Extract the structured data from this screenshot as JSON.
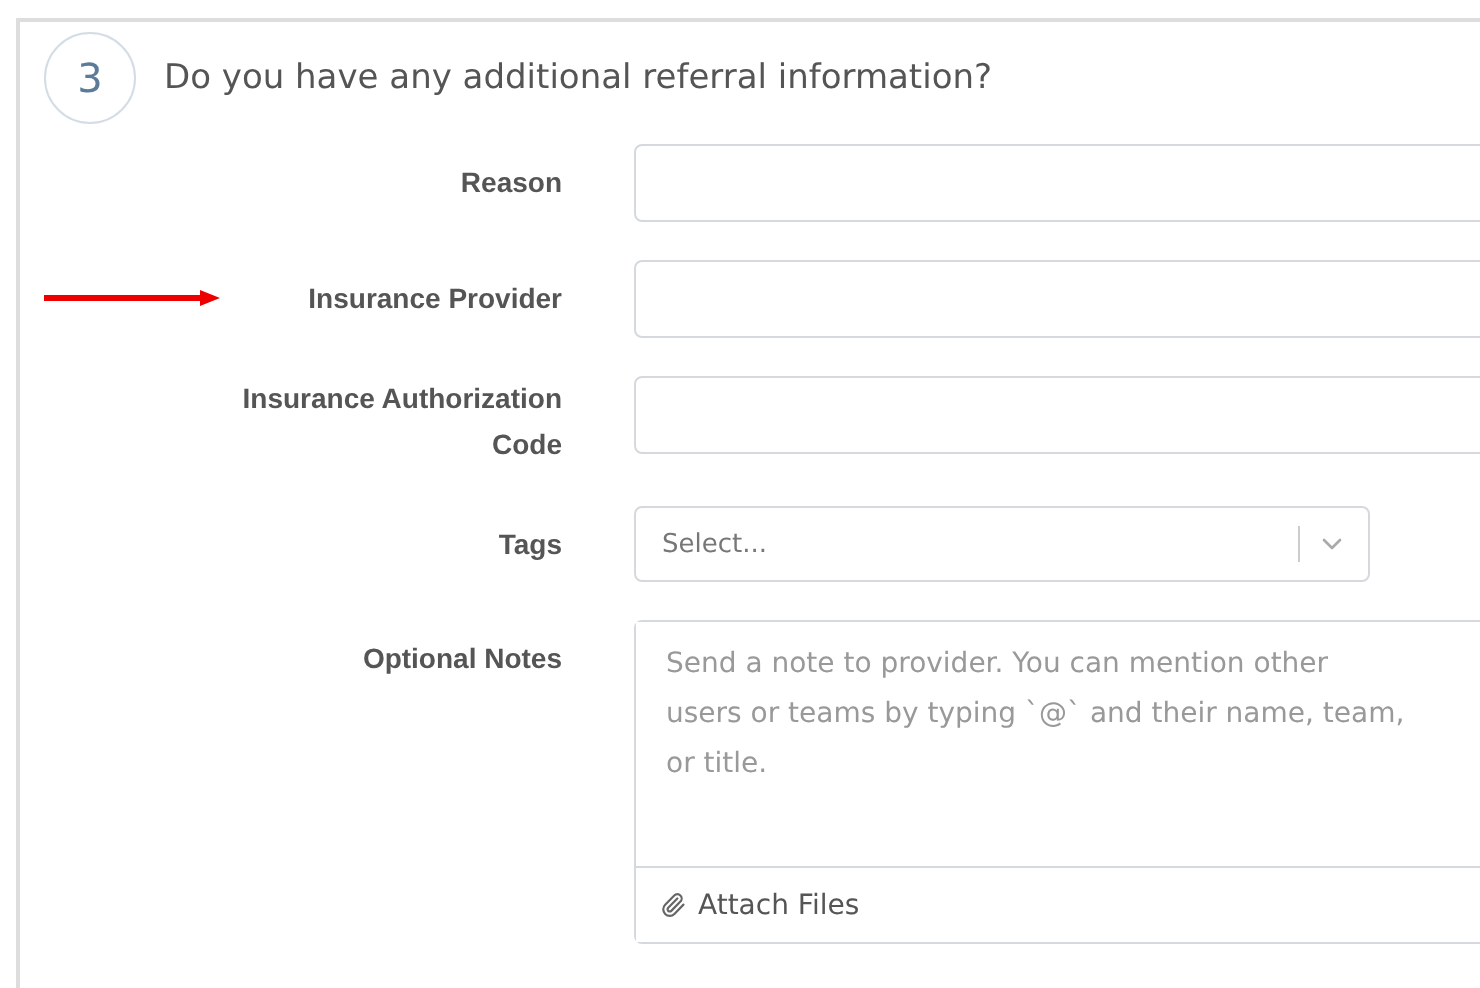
{
  "section": {
    "step": "3",
    "title": "Do you have any additional referral information?"
  },
  "fields": [
    {
      "kind": "text",
      "label": "Reason",
      "highlighted": false
    },
    {
      "kind": "text",
      "label": "Insurance Provider",
      "highlighted": true
    },
    {
      "kind": "text",
      "label": "Insurance Authorization Code",
      "highlighted": false
    },
    {
      "kind": "select",
      "label": "Tags",
      "placeholder": "Select...",
      "highlighted": false
    },
    {
      "kind": "notes",
      "label": "Optional Notes",
      "placeholder": "Send a note to provider. You can mention other users or teams by typing `@` and their name, team, or title.",
      "attach": "Attach Files",
      "highlighted": false
    }
  ]
}
